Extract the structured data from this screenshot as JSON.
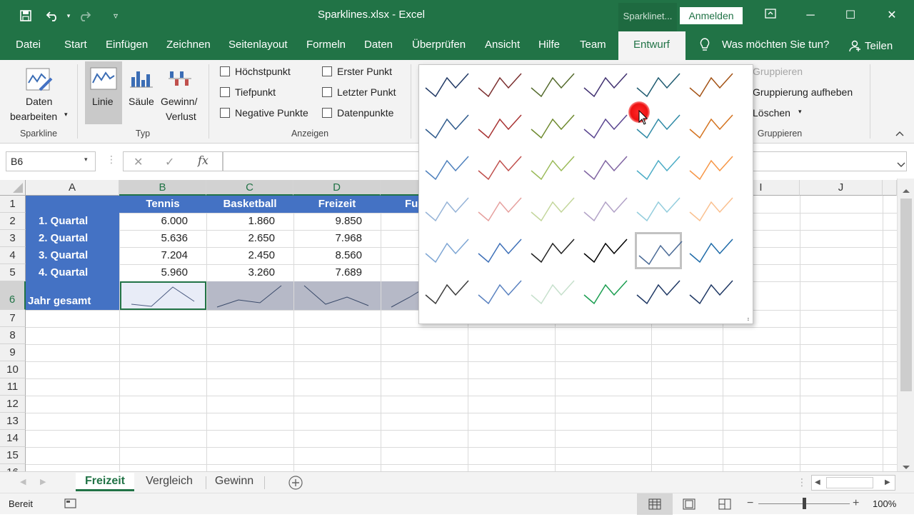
{
  "window": {
    "title": "Sparklines.xlsx  -  Excel",
    "context_tab": "Sparklinet...",
    "signin": "Anmelden"
  },
  "tabs": [
    "Datei",
    "Start",
    "Einfügen",
    "Zeichnen",
    "Seitenlayout",
    "Formeln",
    "Daten",
    "Überprüfen",
    "Ansicht",
    "Hilfe",
    "Team",
    "Entwurf"
  ],
  "tell_me": "Was möchten Sie tun?",
  "share": "Teilen",
  "ribbon": {
    "sparkline": {
      "edit_line1": "Daten",
      "edit_line2": "bearbeiten",
      "group": "Sparkline"
    },
    "typ": {
      "linie": "Linie",
      "saeule": "Säule",
      "gewinn1": "Gewinn/",
      "gewinn2": "Verlust",
      "group": "Typ"
    },
    "anzeigen": {
      "hoechstpunkt": "Höchstpunkt",
      "tiefpunkt": "Tiefpunkt",
      "negative": "Negative Punkte",
      "erster": "Erster Punkt",
      "letzter": "Letzter Punkt",
      "datenpunkte": "Datenpunkte",
      "group": "Anzeigen"
    },
    "gruppieren": {
      "gruppieren": "Gruppieren",
      "aufheben": "Gruppierung aufheben",
      "loeschen": "Löschen",
      "group": "Gruppieren"
    }
  },
  "namebox": "B6",
  "fx": "fx",
  "columns": [
    "A",
    "B",
    "C",
    "D",
    "I",
    "J"
  ],
  "rows": [
    "1",
    "2",
    "3",
    "4",
    "5",
    "6",
    "7",
    "8",
    "9",
    "10",
    "11",
    "12",
    "13",
    "14",
    "15",
    "16"
  ],
  "table": {
    "headers": [
      "Tennis",
      "Basketball",
      "Freizeit",
      "Fu"
    ],
    "rows": [
      {
        "label": "1. Quartal",
        "values": [
          "6.000",
          "1.860",
          "9.850"
        ]
      },
      {
        "label": "2. Quartal",
        "values": [
          "5.636",
          "2.650",
          "7.968"
        ]
      },
      {
        "label": "3. Quartal",
        "values": [
          "7.204",
          "2.450",
          "8.560"
        ]
      },
      {
        "label": "4. Quartal",
        "values": [
          "5.960",
          "3.260",
          "7.689"
        ]
      }
    ],
    "total_label": "Jahr gesamt"
  },
  "gallery": {
    "colors": [
      [
        "#203864",
        "#7b2f2f",
        "#546a2c",
        "#403070",
        "#1f5b70",
        "#a35214"
      ],
      [
        "#2e5a8c",
        "#a83232",
        "#6e8a2e",
        "#5a4590",
        "#2f8aa6",
        "#d4731f"
      ],
      [
        "#4f81bd",
        "#c0504d",
        "#9bbb59",
        "#8064a2",
        "#4bacc6",
        "#f79646"
      ],
      [
        "#95b3d7",
        "#e6a09e",
        "#c3d69b",
        "#b2a2c7",
        "#93cddd",
        "#fac08f"
      ],
      [
        "#7ea6d4",
        "#3e70b8",
        "#202020",
        "#000000",
        "#4a6a96",
        "#1f6ba8"
      ],
      [
        "#3b3b3b",
        "#5a82c0",
        "#c6e0cc",
        "#1a9e50",
        "#1f3864",
        "#1f3864"
      ]
    ]
  },
  "sheets": [
    "Freizeit",
    "Vergleich",
    "Gewinn"
  ],
  "status": {
    "ready": "Bereit",
    "zoom": "100%"
  }
}
